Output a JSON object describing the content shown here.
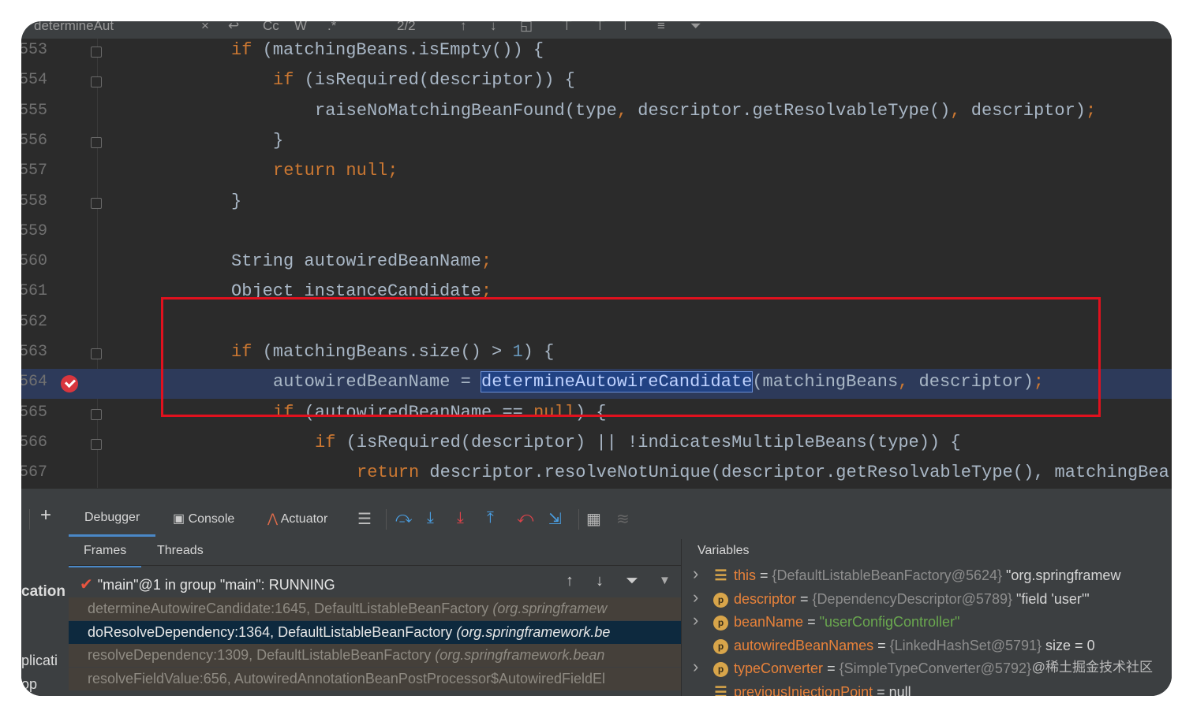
{
  "search": {
    "query": "determineAut",
    "match_count": "2/2"
  },
  "editor": {
    "lines": [
      {
        "num": "553",
        "code": [
          {
            "t": "kw",
            "v": "if"
          },
          {
            "t": "",
            "v": " (matchingBeans.isEmpty()) {"
          }
        ]
      },
      {
        "num": "554",
        "code": [
          {
            "t": "kw",
            "v": "if"
          },
          {
            "t": "",
            "v": " (isRequired(descriptor)) {"
          }
        ]
      },
      {
        "num": "555",
        "code": [
          {
            "t": "",
            "v": "raiseNoMatchingBeanFound(type"
          },
          {
            "t": "kw",
            "v": ","
          },
          {
            "t": "",
            "v": " descriptor.getResolvableType()"
          },
          {
            "t": "kw",
            "v": ","
          },
          {
            "t": "",
            "v": " descriptor)"
          },
          {
            "t": "kw",
            "v": ";"
          }
        ]
      },
      {
        "num": "556",
        "code": [
          {
            "t": "",
            "v": "}"
          }
        ]
      },
      {
        "num": "557",
        "code": [
          {
            "t": "kw",
            "v": "return null;"
          }
        ]
      },
      {
        "num": "558",
        "code": [
          {
            "t": "",
            "v": "}"
          }
        ]
      },
      {
        "num": "559",
        "code": []
      },
      {
        "num": "560",
        "code": [
          {
            "t": "",
            "v": "String autowiredBeanName"
          },
          {
            "t": "kw",
            "v": ";"
          }
        ]
      },
      {
        "num": "561",
        "code": [
          {
            "t": "",
            "v": "Object instanceCandidate"
          },
          {
            "t": "kw",
            "v": ";"
          }
        ]
      },
      {
        "num": "562",
        "code": []
      },
      {
        "num": "563",
        "code": [
          {
            "t": "kw",
            "v": "if"
          },
          {
            "t": "",
            "v": " (matchingBeans.size() > "
          },
          {
            "t": "num",
            "v": "1"
          },
          {
            "t": "",
            "v": ") {"
          }
        ]
      },
      {
        "num": "564",
        "code": [
          {
            "t": "",
            "v": "autowiredBeanName = "
          },
          {
            "t": "hl",
            "v": "determineAutowireCandidate"
          },
          {
            "t": "",
            "v": "(matchingBeans"
          },
          {
            "t": "kw",
            "v": ","
          },
          {
            "t": "",
            "v": " descriptor)"
          },
          {
            "t": "kw",
            "v": ";"
          }
        ]
      },
      {
        "num": "565",
        "code": [
          {
            "t": "kw",
            "v": "if"
          },
          {
            "t": "",
            "v": " (autowiredBeanName == "
          },
          {
            "t": "kw",
            "v": "null"
          },
          {
            "t": "",
            "v": ") {"
          }
        ]
      },
      {
        "num": "566",
        "code": [
          {
            "t": "kw",
            "v": "if"
          },
          {
            "t": "",
            "v": " (isRequired(descriptor) || !indicatesMultipleBeans(type)) {"
          }
        ]
      },
      {
        "num": "567",
        "code": [
          {
            "t": "kw",
            "v": "return"
          },
          {
            "t": "",
            "v": " descriptor.resolveNotUnique(descriptor.getResolvableType(), matchingBea"
          }
        ]
      }
    ]
  },
  "toolbar": {
    "add_label": "+",
    "tabs": [
      "Debugger",
      "Console",
      "Actuator"
    ]
  },
  "left_strip": [
    "cation",
    "plicati",
    "op"
  ],
  "frames": {
    "tabs": [
      "Frames",
      "Threads"
    ],
    "thread": "\"main\"@1 in group \"main\": RUNNING",
    "rows": [
      {
        "method": "determineAutowireCandidate:1645, DefaultListableBeanFactory",
        "pkg": "(org.springframew"
      },
      {
        "method": "doResolveDependency:1364, DefaultListableBeanFactory",
        "pkg": "(org.springframework.be"
      },
      {
        "method": "resolveDependency:1309, DefaultListableBeanFactory",
        "pkg": "(org.springframework.bean"
      },
      {
        "method": "resolveFieldValue:656, AutowiredAnnotationBeanPostProcessor$AutowiredFieldEl",
        "pkg": ""
      }
    ]
  },
  "variables": {
    "title": "Variables",
    "rows": [
      {
        "icon": "list",
        "name": "this",
        "ref": "{DefaultListableBeanFactory@5624}",
        "extra": " \"org.springframew"
      },
      {
        "icon": "p",
        "name": "descriptor",
        "ref": "{DependencyDescriptor@5789}",
        "extra": " \"field 'user'\""
      },
      {
        "icon": "p",
        "name": "beanName",
        "ref": "\"userConfigController\"",
        "extra": ""
      },
      {
        "icon": "p",
        "name": "autowiredBeanNames",
        "ref": "{LinkedHashSet@5791}",
        "extra": "  size = 0"
      },
      {
        "icon": "p",
        "name": "typeConverter",
        "ref": "{SimpleTypeConverter@5792}",
        "extra": ""
      },
      {
        "icon": "list",
        "name": "previousInjectionPoint",
        "ref": "null",
        "extra": ""
      }
    ]
  },
  "watermark": "@稀土掘金技术社区",
  "colors": {
    "accent": "#4a88c7",
    "redbox": "#e0111e",
    "keyword": "#cc7832",
    "number": "#6897bb"
  }
}
